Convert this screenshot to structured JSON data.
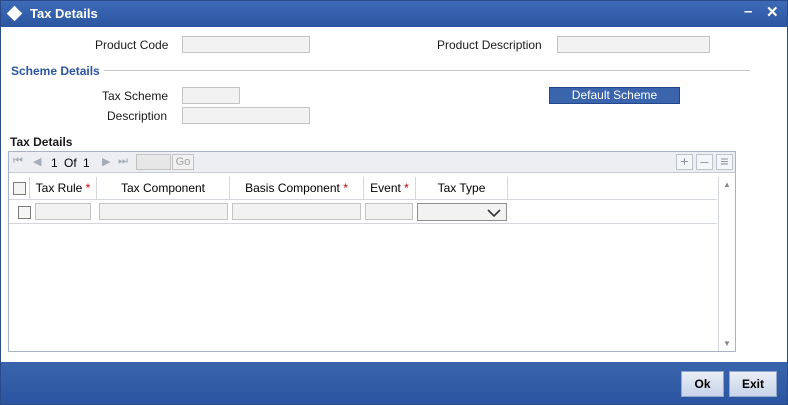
{
  "window": {
    "title": "Tax Details",
    "minimize": "–",
    "close": "✕"
  },
  "form": {
    "product_code_label": "Product Code",
    "product_desc_label": "Product Description",
    "scheme_section": "Scheme Details",
    "tax_scheme_label": "Tax Scheme",
    "description_label": "Description",
    "default_scheme_button": "Default Scheme"
  },
  "grid": {
    "section_title": "Tax Details",
    "pager": {
      "current": "1",
      "of_label": "Of",
      "total": "1",
      "go_label": "Go"
    },
    "toolbar": {
      "add": "+",
      "delete": "–",
      "view": "≡"
    },
    "columns": [
      {
        "label": "Tax Rule",
        "required": "*"
      },
      {
        "label": "Tax Component",
        "required": ""
      },
      {
        "label": "Basis Component",
        "required": "*"
      },
      {
        "label": "Event",
        "required": "*"
      },
      {
        "label": "Tax Type",
        "required": ""
      }
    ]
  },
  "footer": {
    "ok": "Ok",
    "exit": "Exit"
  }
}
